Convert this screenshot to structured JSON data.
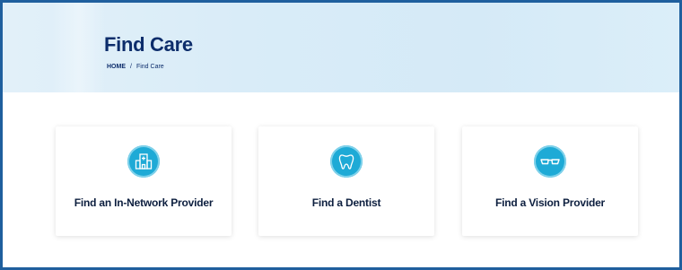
{
  "header": {
    "title": "Find Care",
    "breadcrumb": {
      "home": "HOME",
      "separator": "/",
      "current": "Find Care"
    }
  },
  "cards": [
    {
      "label": "Find an In-Network Provider",
      "icon": "hospital-icon"
    },
    {
      "label": "Find a Dentist",
      "icon": "tooth-icon"
    },
    {
      "label": "Find a Vision Provider",
      "icon": "glasses-icon"
    }
  ],
  "colors": {
    "brand_navy": "#0d2d6b",
    "icon_teal": "#1eaad6",
    "frame_blue": "#1f5f9e",
    "hero_bg": "#d9ecf8"
  }
}
